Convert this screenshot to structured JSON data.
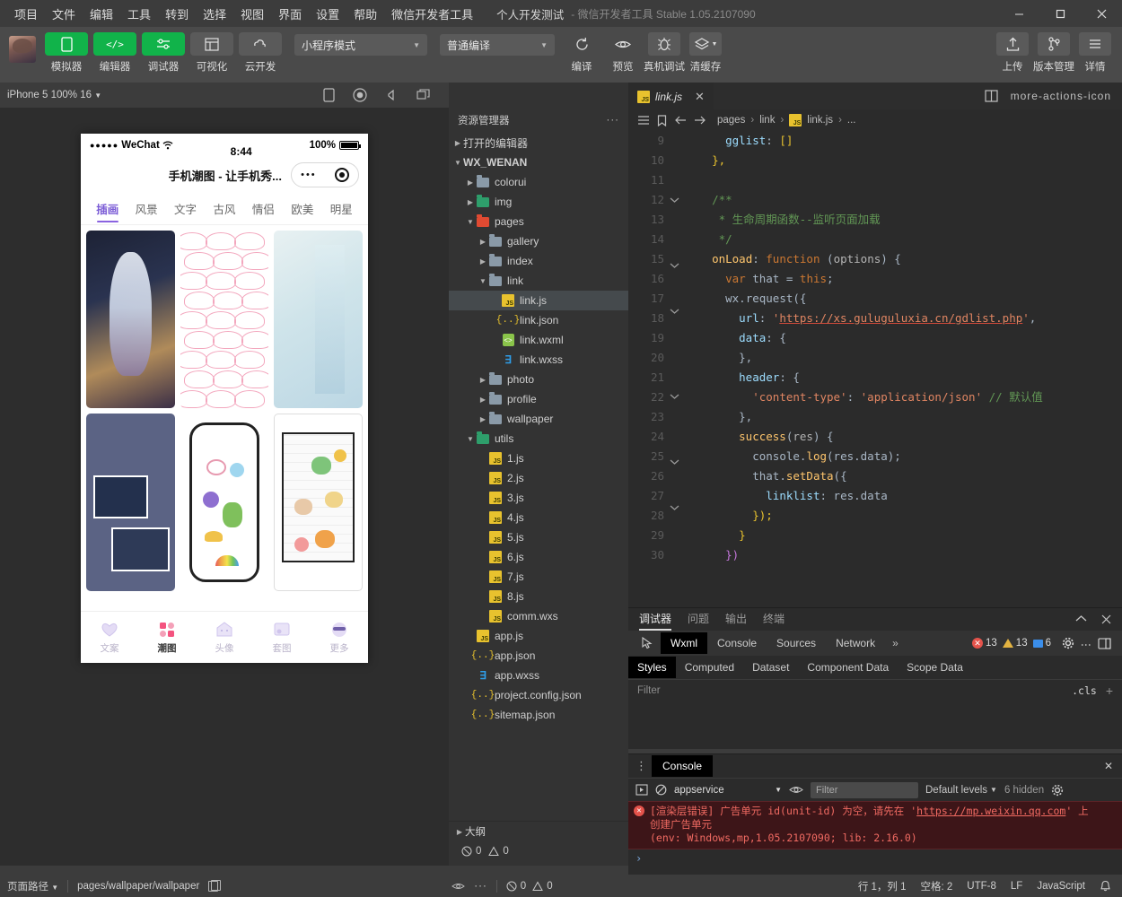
{
  "titlebar": {
    "menus": [
      "项目",
      "文件",
      "编辑",
      "工具",
      "转到",
      "选择",
      "视图",
      "界面",
      "设置",
      "帮助",
      "微信开发者工具"
    ],
    "project": "个人开发测试",
    "dash": "-",
    "app_name": "微信开发者工具 Stable 1.05.2107090",
    "minimize": "─",
    "maximize": "▢",
    "close": "✕"
  },
  "toolbar": {
    "buttons": [
      {
        "label": "模拟器",
        "icon": "phone-icon",
        "style": "green"
      },
      {
        "label": "编辑器",
        "icon": "code-icon",
        "style": "green"
      },
      {
        "label": "调试器",
        "icon": "sliders-icon",
        "style": "green"
      },
      {
        "label": "可视化",
        "icon": "layout-icon",
        "style": "grey"
      },
      {
        "label": "云开发",
        "icon": "cloud-icon",
        "style": "grey"
      }
    ],
    "mode_select": "小程序模式",
    "compile_select": "普通编译",
    "actions": [
      {
        "label": "编译",
        "icon": "refresh-icon"
      },
      {
        "label": "预览",
        "icon": "eye-icon"
      },
      {
        "label": "真机调试",
        "icon": "bug-icon"
      },
      {
        "label": "清缓存",
        "icon": "layers-icon"
      }
    ],
    "right_actions": [
      {
        "label": "上传",
        "icon": "upload-icon"
      },
      {
        "label": "版本管理",
        "icon": "branch-icon"
      },
      {
        "label": "详情",
        "icon": "menu-icon"
      }
    ]
  },
  "simulator": {
    "device": "iPhone 5 100% 16",
    "icons": [
      "rotate-device-icon",
      "record-icon",
      "volume-icon",
      "multi-window-icon"
    ],
    "phone": {
      "carrier": "WeChat",
      "signal_dots": "●●●●●",
      "wifi": "wifi-icon",
      "time": "8:44",
      "battery_pct": "100%",
      "nav_title": "手机潮图 - 让手机秀...",
      "capsule_dots": "•••",
      "tabs": [
        "插画",
        "风景",
        "文字",
        "古风",
        "情侣",
        "欧美",
        "明星"
      ],
      "active_tab": "插画",
      "tabbar": [
        {
          "label": "文案",
          "icon": "heart-balloon-icon"
        },
        {
          "label": "潮图",
          "icon": "grid-squares-icon"
        },
        {
          "label": "头像",
          "icon": "ghost-icon"
        },
        {
          "label": "套图",
          "icon": "frame-icon"
        },
        {
          "label": "更多",
          "icon": "sunglasses-face-icon"
        }
      ],
      "active_tabbar": "潮图"
    }
  },
  "explorer": {
    "activity_icons": [
      "files-icon",
      "search-icon",
      "source-control-icon",
      "extensions-icon",
      "debug-icon",
      "collapse-icon"
    ],
    "title": "资源管理器",
    "more": "···",
    "tree": [
      {
        "label": "打开的编辑器",
        "depth": 0,
        "type": "section",
        "arrow": "right"
      },
      {
        "label": "WX_WENAN",
        "depth": 0,
        "type": "section",
        "arrow": "down"
      },
      {
        "label": "colorui",
        "depth": 1,
        "type": "folder",
        "arrow": "right"
      },
      {
        "label": "img",
        "depth": 1,
        "type": "folder-green",
        "arrow": "right"
      },
      {
        "label": "pages",
        "depth": 1,
        "type": "folder-red",
        "arrow": "down"
      },
      {
        "label": "gallery",
        "depth": 2,
        "type": "folder",
        "arrow": "right"
      },
      {
        "label": "index",
        "depth": 2,
        "type": "folder",
        "arrow": "right"
      },
      {
        "label": "link",
        "depth": 2,
        "type": "folder-open",
        "arrow": "down"
      },
      {
        "label": "link.js",
        "depth": 3,
        "type": "js",
        "arrow": "none",
        "selected": true
      },
      {
        "label": "link.json",
        "depth": 3,
        "type": "json",
        "arrow": "none"
      },
      {
        "label": "link.wxml",
        "depth": 3,
        "type": "wxml",
        "arrow": "none"
      },
      {
        "label": "link.wxss",
        "depth": 3,
        "type": "wxss",
        "arrow": "none"
      },
      {
        "label": "photo",
        "depth": 2,
        "type": "folder",
        "arrow": "right"
      },
      {
        "label": "profile",
        "depth": 2,
        "type": "folder",
        "arrow": "right"
      },
      {
        "label": "wallpaper",
        "depth": 2,
        "type": "folder",
        "arrow": "right"
      },
      {
        "label": "utils",
        "depth": 1,
        "type": "folder-green",
        "arrow": "down"
      },
      {
        "label": "1.js",
        "depth": 2,
        "type": "js",
        "arrow": "none"
      },
      {
        "label": "2.js",
        "depth": 2,
        "type": "js",
        "arrow": "none"
      },
      {
        "label": "3.js",
        "depth": 2,
        "type": "js",
        "arrow": "none"
      },
      {
        "label": "4.js",
        "depth": 2,
        "type": "js",
        "arrow": "none"
      },
      {
        "label": "5.js",
        "depth": 2,
        "type": "js",
        "arrow": "none"
      },
      {
        "label": "6.js",
        "depth": 2,
        "type": "js",
        "arrow": "none"
      },
      {
        "label": "7.js",
        "depth": 2,
        "type": "js",
        "arrow": "none"
      },
      {
        "label": "8.js",
        "depth": 2,
        "type": "js",
        "arrow": "none"
      },
      {
        "label": "comm.wxs",
        "depth": 2,
        "type": "js",
        "arrow": "none"
      },
      {
        "label": "app.js",
        "depth": 1,
        "type": "js",
        "arrow": "none"
      },
      {
        "label": "app.json",
        "depth": 1,
        "type": "json",
        "arrow": "none"
      },
      {
        "label": "app.wxss",
        "depth": 1,
        "type": "wxss",
        "arrow": "none"
      },
      {
        "label": "project.config.json",
        "depth": 1,
        "type": "json",
        "arrow": "none"
      },
      {
        "label": "sitemap.json",
        "depth": 1,
        "type": "json",
        "arrow": "none"
      }
    ],
    "outline_title": "大纲",
    "outline_errors": "0",
    "outline_warnings": "0"
  },
  "editor": {
    "tab": {
      "name": "link.js",
      "icon": "js-icon",
      "close": "✕"
    },
    "split_icon": "split-editor-icon",
    "more_icon": "more-actions-icon",
    "breadcrumb": [
      "pages",
      "link",
      "link.js",
      "..."
    ],
    "breadcrumb_icons": [
      "list-icon",
      "bookmark-icon",
      "back-arrow-icon",
      "forward-arrow-icon"
    ],
    "first_line_number": 9,
    "lines": [
      {
        "n": 9,
        "fold": false,
        "html": "    <span class='k-key'>gglist</span><span class='k-punc'>:</span> <span class='k-brkt'>[]</span>"
      },
      {
        "n": 10,
        "fold": false,
        "html": "  <span class='k-brkt'>},</span>"
      },
      {
        "n": 11,
        "fold": false,
        "html": ""
      },
      {
        "n": 12,
        "fold": true,
        "html": "  <span class='k-cmt'>/**</span>"
      },
      {
        "n": 13,
        "fold": false,
        "html": "   <span class='k-cmt'>* 生命周期函数--监听页面加载</span>"
      },
      {
        "n": 14,
        "fold": false,
        "html": "   <span class='k-cmt'>*/</span>"
      },
      {
        "n": 15,
        "fold": true,
        "html": "  <span class='k-fn'>onLoad</span><span class='k-punc'>:</span> <span class='k-kw'>function</span> <span class='k-punc'>(</span><span class='k-param'>options</span><span class='k-punc'>) {</span>"
      },
      {
        "n": 16,
        "fold": false,
        "html": "    <span class='k-kw'>var</span> <span class='k-id'>that</span> <span class='k-punc'>=</span> <span class='k-kw'>this</span><span class='k-punc'>;</span>"
      },
      {
        "n": 17,
        "fold": true,
        "html": "    <span class='k-id'>wx</span><span class='k-punc'>.</span><span class='k-id'>request</span><span class='k-punc'>({</span>"
      },
      {
        "n": 18,
        "fold": false,
        "html": "      <span class='k-key'>url</span><span class='k-punc'>:</span> <span class='k-str'>'</span><span class='k-url'>https://xs.guluguluxia.cn/gdlist.php</span><span class='k-str'>'</span><span class='k-punc'>,</span>"
      },
      {
        "n": 19,
        "fold": false,
        "html": "      <span class='k-key'>data</span><span class='k-punc'>: {</span>"
      },
      {
        "n": 20,
        "fold": false,
        "html": "      <span class='k-punc'>},</span>"
      },
      {
        "n": 21,
        "fold": true,
        "html": "      <span class='k-key'>header</span><span class='k-punc'>: {</span>"
      },
      {
        "n": 22,
        "fold": false,
        "html": "        <span class='k-str'>'content-type'</span><span class='k-punc'>:</span> <span class='k-str'>'application/json'</span> <span class='k-cmt'>// 默认值</span>"
      },
      {
        "n": 23,
        "fold": false,
        "html": "      <span class='k-punc'>},</span>"
      },
      {
        "n": 24,
        "fold": true,
        "html": "      <span class='k-fn'>success</span><span class='k-punc'>(</span><span class='k-param'>res</span><span class='k-punc'>) {</span>"
      },
      {
        "n": 25,
        "fold": false,
        "html": "        <span class='k-id'>console</span><span class='k-punc'>.</span><span class='k-fn'>log</span><span class='k-punc'>(</span><span class='k-id'>res</span><span class='k-punc'>.</span><span class='k-id'>data</span><span class='k-punc'>);</span>"
      },
      {
        "n": 26,
        "fold": true,
        "html": "        <span class='k-id'>that</span><span class='k-punc'>.</span><span class='k-fn'>setData</span><span class='k-punc'>({</span>"
      },
      {
        "n": 27,
        "fold": false,
        "html": "          <span class='k-key'>linklist</span><span class='k-punc'>:</span> <span class='k-id'>res</span><span class='k-punc'>.</span><span class='k-id'>data</span>"
      },
      {
        "n": 28,
        "fold": false,
        "html": "        <span class='k-brkt'>});</span>"
      },
      {
        "n": 29,
        "fold": false,
        "html": "      <span class='k-brkt'>}</span>"
      },
      {
        "n": 30,
        "fold": false,
        "html": "    <span class='k-magenta'>})</span>"
      }
    ]
  },
  "debugger": {
    "panel_tabs": [
      "调试器",
      "问题",
      "输出",
      "终端"
    ],
    "active_panel_tab": "调试器",
    "collapse_icon": "chevron-up-icon",
    "close_icon": "close-icon",
    "devtool_tabs": [
      "Wxml",
      "Console",
      "Sources",
      "Network"
    ],
    "active_devtool_tab": "Wxml",
    "inspect_icon": "inspect-icon",
    "more_tabs": "»",
    "counts": {
      "errors": "13",
      "warnings": "13",
      "info": "6"
    },
    "gear_icon": "gear-icon",
    "kebab_icon": "kebab-menu-icon",
    "dock_icon": "dock-icon",
    "style_tabs": [
      "Styles",
      "Computed",
      "Dataset",
      "Component Data",
      "Scope Data"
    ],
    "active_style_tab": "Styles",
    "filter_placeholder": "Filter",
    "cls_label": ".cls",
    "plus": "+"
  },
  "console": {
    "grip": "⋮",
    "tab": "Console",
    "close": "✕",
    "play_icon": "execution-context-icon",
    "clear_icon": "clear-console-icon",
    "context": "appservice",
    "eye_icon": "eye-icon",
    "filter_placeholder": "Filter",
    "levels": "Default levels",
    "hidden": "6 hidden",
    "gear_icon": "gear-icon",
    "error_line1": "[渲染层错误] 广告单元 id(unit-id) 为空，请先在 ",
    "error_url": "https://mp.weixin.qq.com",
    "error_line1_tail": " 上",
    "error_line2": "创建广告单元",
    "error_line3": "(env: Windows,mp,1.05.2107090; lib: 2.16.0)",
    "prompt": "›"
  },
  "status": {
    "page_path_label": "页面路径",
    "page_path_value": "pages/wallpaper/wallpaper",
    "copy_icon": "copy-icon",
    "eye_icon": "eye-icon",
    "more_icon": "more-icon",
    "line_col": "行 1，列 1",
    "spaces": "空格: 2",
    "encoding": "UTF-8",
    "eol": "LF",
    "language": "JavaScript",
    "bell_icon": "bell-icon"
  }
}
